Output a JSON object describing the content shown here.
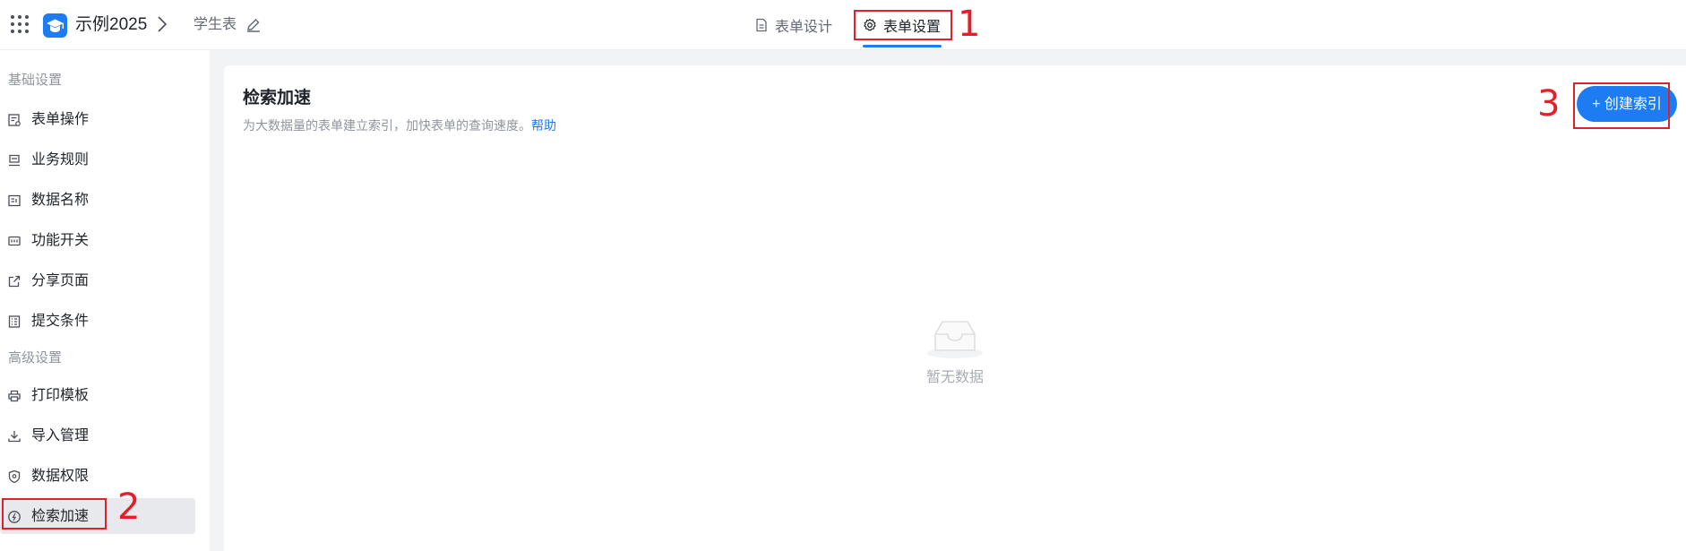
{
  "header": {
    "app_name": "示例2025",
    "page_name": "学生表",
    "tabs": [
      {
        "label": "表单设计"
      },
      {
        "label": "表单设置"
      }
    ]
  },
  "sidebar": {
    "groups": [
      {
        "title": "基础设置",
        "items": [
          {
            "label": "表单操作"
          },
          {
            "label": "业务规则"
          },
          {
            "label": "数据名称"
          },
          {
            "label": "功能开关"
          },
          {
            "label": "分享页面"
          },
          {
            "label": "提交条件"
          }
        ]
      },
      {
        "title": "高级设置",
        "items": [
          {
            "label": "打印模板"
          },
          {
            "label": "导入管理"
          },
          {
            "label": "数据权限"
          },
          {
            "label": "检索加速"
          }
        ]
      }
    ]
  },
  "main": {
    "title": "检索加速",
    "description": "为大数据量的表单建立索引，加快表单的查询速度。",
    "help_link": "帮助",
    "create_button": "+ 创建索引",
    "empty_text": "暂无数据"
  },
  "annotations": {
    "labels": [
      "1",
      "2",
      "3"
    ],
    "color": "#e0202a"
  },
  "colors": {
    "accent": "#1d7cf2",
    "annotation": "#e0202a"
  }
}
